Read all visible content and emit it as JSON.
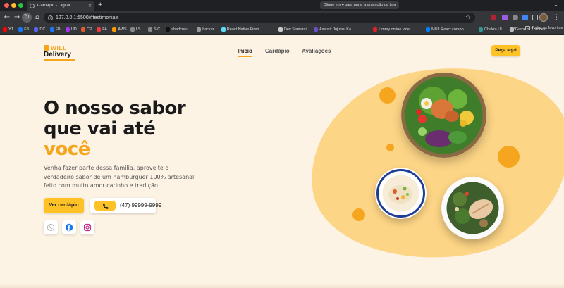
{
  "browser": {
    "tab_title": "Cardápio - Digital",
    "new_tab": "+",
    "recording_notice": "Clique em ⏺ para parar a gravação da tela",
    "url": "127.0.0.1:5500/#testimonials",
    "bookmarks": [
      {
        "label": "YT",
        "color": "#ff0000"
      },
      {
        "label": "FB",
        "color": "#1877f2"
      },
      {
        "label": "DC",
        "color": "#5865f2"
      },
      {
        "label": "FB",
        "color": "#1877f2"
      },
      {
        "label": "UD",
        "color": "#a435f0"
      },
      {
        "label": "CP",
        "color": "#e05a2b"
      },
      {
        "label": "FA",
        "color": "#f03c3c"
      },
      {
        "label": "AWS",
        "color": "#ff9900"
      },
      {
        "label": "I S",
        "color": "#888888"
      },
      {
        "label": "S C",
        "color": "#888888"
      },
      {
        "label": "shadcn/ui",
        "color": "#111111"
      },
      {
        "label": "hacker",
        "color": "#999999"
      },
      {
        "label": "React Native Fireb...",
        "color": "#61dafb"
      },
      {
        "label": "Dev Samurai",
        "color": "#cccccc"
      },
      {
        "label": "Assistir Jujutsu Ka...",
        "color": "#6a4ecb"
      },
      {
        "label": "Ummy online vide...",
        "color": "#e02424"
      },
      {
        "label": "MUI: React compo...",
        "color": "#007fff"
      },
      {
        "label": "Chakra UI",
        "color": "#319795"
      },
      {
        "label": "Game of Thrones...",
        "color": "#bbbbbb"
      }
    ],
    "bookmarks_more": "»",
    "all_bookmarks": "Todos os favoritos"
  },
  "site": {
    "logo_top": "WILL",
    "logo_bottom": "Delivery",
    "nav": [
      "Início",
      "Cardápio",
      "Avaliações"
    ],
    "order_button": "Peça aqui"
  },
  "hero": {
    "headline_line1": "O nosso sabor",
    "headline_line2": "que vai até",
    "headline_accent": "você",
    "lead_lines": [
      "Venha fazer parte dessa família, aproveite o",
      "verdadeiro sabor de um hamburguer 100% artesanal",
      "feito com muito amor carinho e tradição."
    ],
    "menu_button": "Ver cardápio",
    "phone_label": "(47) 99999-9999"
  },
  "social": [
    "whatsapp-icon",
    "facebook-icon",
    "instagram-icon"
  ],
  "colors": {
    "accent": "#f6a51f",
    "button": "#ffc226",
    "background": "#fdf3e4",
    "blob": "#fdd586",
    "text": "#1a1a1a"
  }
}
